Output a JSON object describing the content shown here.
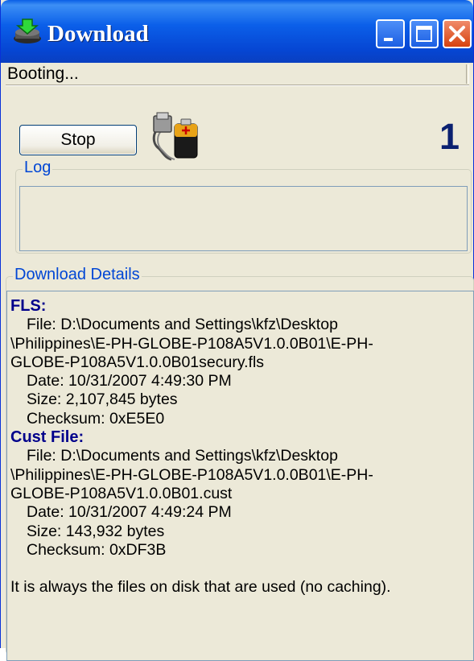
{
  "window": {
    "title": "Download",
    "colors": {
      "titlebar": "#0a5ee6",
      "accent": "#0046d5",
      "counter": "#0a2070"
    }
  },
  "titlebar_buttons": {
    "minimize_icon": "minimize-icon",
    "maximize_icon": "maximize-icon",
    "close_icon": "close-icon"
  },
  "status": {
    "text": "Booting..."
  },
  "controls": {
    "stop_label": "Stop",
    "battery_icon": "battery-usb-icon",
    "counter": "1"
  },
  "log": {
    "label": "Log",
    "content": ""
  },
  "details": {
    "label": "Download Details",
    "fls": {
      "heading": "FLS:",
      "file_line1": "File: D:\\Documents and Settings\\kfz\\Desktop",
      "file_line2": "\\Philippines\\E-PH-GLOBE-P108A5V1.0.0B01\\E-PH-",
      "file_line3": "GLOBE-P108A5V1.0.0B01secury.fls",
      "date": "Date: 10/31/2007 4:49:30 PM",
      "size": "Size: 2,107,845 bytes",
      "checksum": "Checksum: 0xE5E0"
    },
    "cust": {
      "heading": "Cust File:",
      "file_line1": "File: D:\\Documents and Settings\\kfz\\Desktop",
      "file_line2": "\\Philippines\\E-PH-GLOBE-P108A5V1.0.0B01\\E-PH-",
      "file_line3": "GLOBE-P108A5V1.0.0B01.cust",
      "date": "Date: 10/31/2007 4:49:24 PM",
      "size": "Size: 143,932 bytes",
      "checksum": "Checksum: 0xDF3B"
    },
    "note": "It is always the files on disk that are used (no caching)."
  }
}
